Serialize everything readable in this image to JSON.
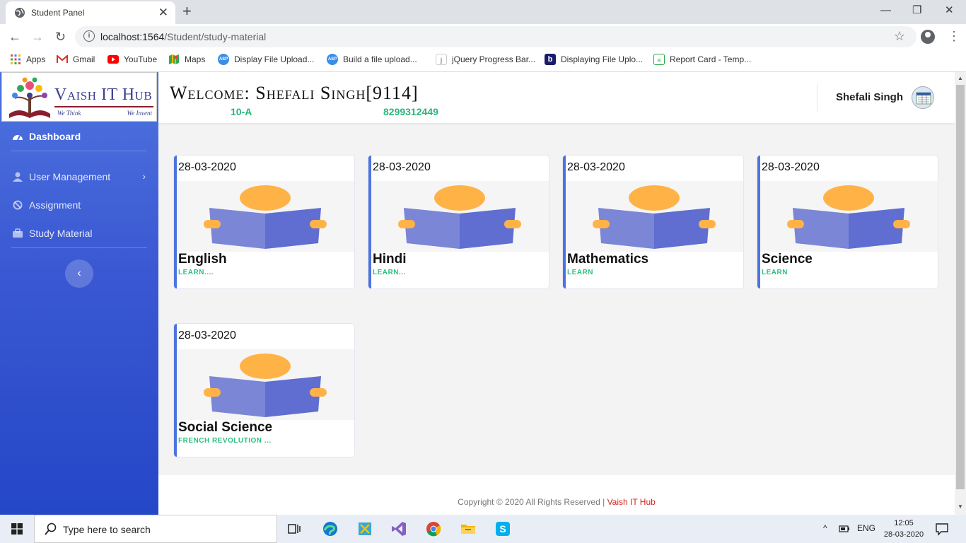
{
  "browser": {
    "tab_title": "Student Panel",
    "tab_close": "✕",
    "new_tab": "+",
    "minimize": "—",
    "restore": "❐",
    "close": "✕",
    "back": "←",
    "forward": "→",
    "reload": "↻",
    "url_host": "localhost:1564",
    "url_path": "/Student/study-material",
    "star": "☆",
    "menu": "⋮",
    "bookmarks": [
      {
        "label": "Apps",
        "icon": "apps-grid-icon",
        "color": "#e24a3b"
      },
      {
        "label": "Gmail",
        "icon": "gmail-icon",
        "color": "#d93025"
      },
      {
        "label": "YouTube",
        "icon": "youtube-icon",
        "color": "#ff0000"
      },
      {
        "label": "Maps",
        "icon": "maps-icon",
        "color": "#34a853"
      },
      {
        "label": "Display File Upload...",
        "icon": "asp-icon",
        "color": "#3a8ee6"
      },
      {
        "label": "Build a file upload...",
        "icon": "asp-icon",
        "color": "#3a8ee6"
      },
      {
        "label": "jQuery Progress Bar...",
        "icon": "jquery-icon",
        "color": "#88a"
      },
      {
        "label": "Displaying File Uplo...",
        "icon": "b-icon",
        "color": "#1c1c6c"
      },
      {
        "label": "Report Card - Temp...",
        "icon": "report-icon",
        "color": "#28a745"
      }
    ]
  },
  "sidebar": {
    "brand_name": "Vaish IT Hub",
    "brand_tag_left": "We Think",
    "brand_tag_right": "We Invent",
    "items": [
      {
        "label": "Dashboard",
        "icon": "tachometer-icon",
        "active": true
      },
      {
        "label": "User Management",
        "icon": "user-icon",
        "chevron": "›"
      },
      {
        "label": "Assignment",
        "icon": "ban-icon"
      },
      {
        "label": "Study Material",
        "icon": "briefcase-icon"
      }
    ],
    "collapse_glyph": "‹"
  },
  "topbar": {
    "welcome": "Welcome: Shefali Singh[9114]",
    "class": "10-A",
    "phone": "8299312449",
    "user_name": "Shefali Singh"
  },
  "cards": [
    {
      "date": "28-03-2020",
      "subject": "English",
      "desc": "LEARN...."
    },
    {
      "date": "28-03-2020",
      "subject": "Hindi",
      "desc": "LEARN..."
    },
    {
      "date": "28-03-2020",
      "subject": "Mathematics",
      "desc": "LEARN"
    },
    {
      "date": "28-03-2020",
      "subject": "Science",
      "desc": "LEARN"
    },
    {
      "date": "28-03-2020",
      "subject": "Social Science",
      "desc": "FRENCH REVOLUTION ..."
    }
  ],
  "footer": {
    "copyright": "Copyright © 2020 All Rights Reserved | ",
    "brand": "Vaish IT Hub"
  },
  "taskbar": {
    "search_placeholder": "Type here to search",
    "tray_chevron": "^",
    "lang": "ENG",
    "time": "12:05",
    "date": "28-03-2020"
  },
  "colors": {
    "sidebar_top": "#4e73df",
    "sidebar_bottom": "#2447c8",
    "accent_green": "#28b57a",
    "brand_red": "#d9231d",
    "book_blue": "#5f6ed0",
    "book_orange": "#ffb347"
  }
}
